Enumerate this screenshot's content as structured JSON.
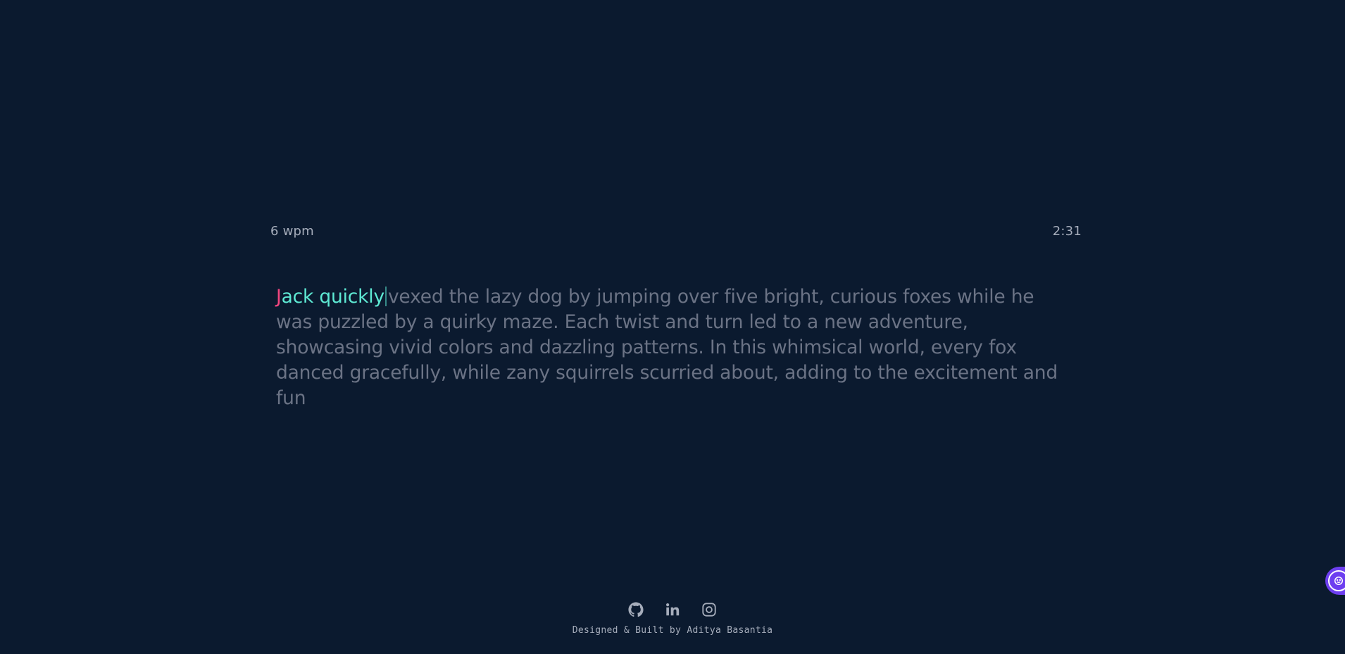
{
  "stats": {
    "wpm": "6 wpm",
    "timer": "2:31"
  },
  "text": {
    "error_chars": "J",
    "correct_chars": "ack quickly",
    "remaining": "vexed the lazy dog by jumping over five bright, curious foxes while he was puzzled by a quirky maze. Each twist and turn led to a new adventure, showcasing vivid colors and dazzling patterns. In this whimsical world, every fox danced gracefully, while zany squirrels scurried about, adding to the excitement and fun"
  },
  "footer": {
    "social": [
      {
        "name": "github-icon"
      },
      {
        "name": "linkedin-icon"
      },
      {
        "name": "instagram-icon"
      }
    ],
    "credit": "Designed & Built by Aditya Basantia"
  },
  "widget": {
    "icon": "smiley-gear-icon"
  },
  "colors": {
    "background": "#0b1a2f",
    "correct": "#5eead4",
    "error": "#f2467f",
    "untyped": "#6b7385",
    "stats": "#a6adbb",
    "widget": "#6d3ff0"
  }
}
